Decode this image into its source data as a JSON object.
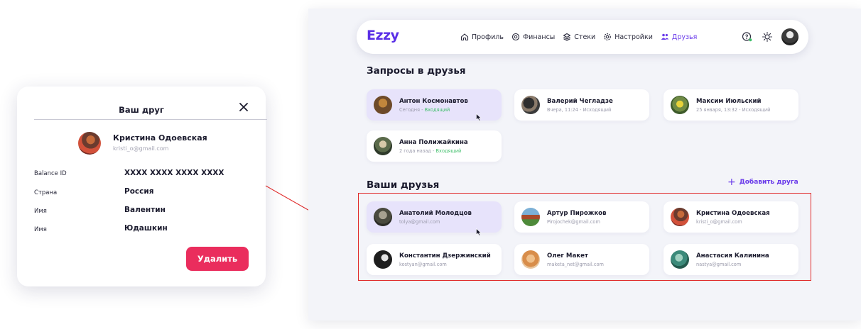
{
  "brand": "Ezzy",
  "nav": {
    "items": [
      {
        "label": "Профиль",
        "icon": "home-icon"
      },
      {
        "label": "Финансы",
        "icon": "coins-icon"
      },
      {
        "label": "Стеки",
        "icon": "stack-icon"
      },
      {
        "label": "Настройки",
        "icon": "gear-icon"
      },
      {
        "label": "Друзья",
        "icon": "friends-icon",
        "active": true
      }
    ],
    "accent": "#6a3bea"
  },
  "requests": {
    "title": "Запросы в друзья",
    "items": [
      {
        "name": "Антон Космонавтов",
        "time": "Сегодня",
        "direction": "Входящий",
        "highlighted": true
      },
      {
        "name": "Валерий Чегладзе",
        "time": "Вчера, 11:24",
        "direction": "Исходящий"
      },
      {
        "name": "Максим Июльский",
        "time": "25 января, 13:32",
        "direction": "Исходящий"
      },
      {
        "name": "Анна Полижайкина",
        "time": "2 года назад",
        "direction": "Входящий"
      }
    ]
  },
  "friends": {
    "title": "Ваши друзья",
    "add_label": "Добавить друга",
    "items": [
      {
        "name": "Анатолий Молодцов",
        "email": "tolya@gmail.com",
        "highlighted": true
      },
      {
        "name": "Артур Пирожков",
        "email": "Pirojochek@gmail.com"
      },
      {
        "name": "Кристина Одоевская",
        "email": "kristi_o@gmail.com"
      },
      {
        "name": "Константин Дзержинский",
        "email": "kostyan@gmail.com"
      },
      {
        "name": "Олег Макет",
        "email": "maketa_net@gmail.com"
      },
      {
        "name": "Анастасия Калинина",
        "email": "nastya@gmail.com"
      }
    ]
  },
  "popup": {
    "title": "Ваш друг",
    "name": "Кристина Одоевская",
    "email": "kristi_o@gmail.com",
    "rows": [
      {
        "label": "Balance ID",
        "value": "XXXX XXXX XXXX XXXX"
      },
      {
        "label": "Страна",
        "value": "Россия"
      },
      {
        "label": "Имя",
        "value": "Валентин"
      },
      {
        "label": "Имя",
        "value": "Юдашкин"
      }
    ],
    "delete_label": "Удалить",
    "delete_color": "#ea2d5d"
  },
  "colors": {
    "incoming": "#3fbf6a",
    "highlight_box": "#e02a2a",
    "card_highlight": "#e7e3fb"
  }
}
